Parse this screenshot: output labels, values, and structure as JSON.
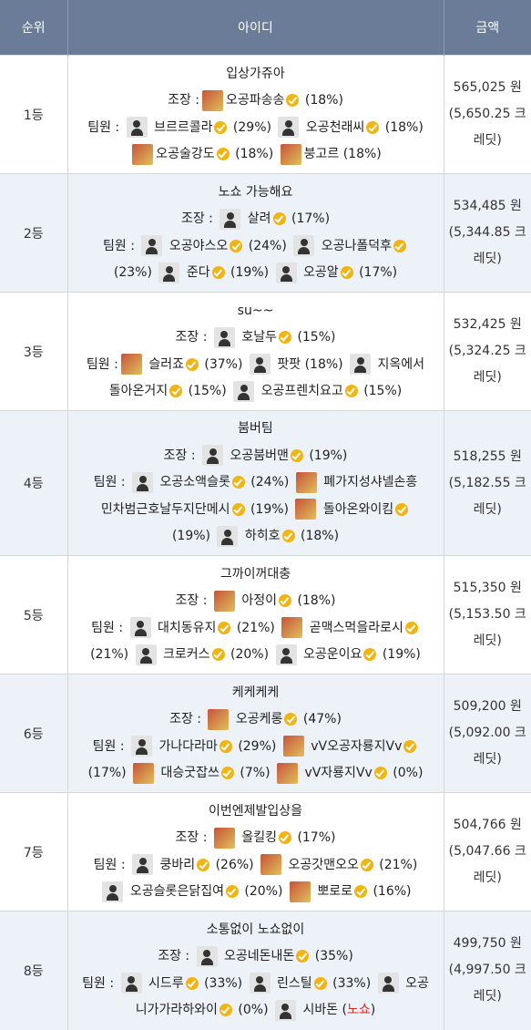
{
  "headers": {
    "rank": "순위",
    "id": "아이디",
    "amount": "금액"
  },
  "rows": [
    {
      "rank": "1등",
      "team": "입상가쥬아",
      "captain": "조장 :",
      "captain_name": "오공파송송",
      "captain_pct": "(18%)",
      "members": "팀원 :",
      "m1": "브르르콜라",
      "p1": "(29%)",
      "m2": "오공천래씨",
      "p2": "(18%)",
      "m3": "오공술강도",
      "p3": "(18%)",
      "m4": "붕고르",
      "p4": "(18%)",
      "amount": "565,025 원",
      "credit_a": "(5,650.25 크",
      "credit_b": "레딧)"
    },
    {
      "rank": "2등",
      "team": "노쇼 가능해요",
      "captain": "조장 :",
      "captain_name": "살려",
      "captain_pct": "(17%)",
      "members": "팀원 :",
      "m1": "오공야스오",
      "p1": "(24%)",
      "m2": "오공나폴덕후",
      "p2": "(23%)",
      "m3": "준다",
      "p3": "(19%)",
      "m4": "오공알",
      "p4": "(17%)",
      "amount": "534,485 원",
      "credit_a": "(5,344.85 크",
      "credit_b": "레딧)"
    },
    {
      "rank": "3등",
      "team": "su~~",
      "captain": "조장 :",
      "captain_name": "호날두",
      "captain_pct": "(15%)",
      "members": "팀원 :",
      "m1": "슬러죠",
      "p1": "(37%)",
      "m2": "팟팟",
      "p2": "(18%)",
      "m3a": "지옥에서",
      "m3b": "돌아온거지",
      "p3": "(15%)",
      "m4": "오공프렌치요고",
      "p4": "(15%)",
      "amount": "532,425 원",
      "credit_a": "(5,324.25 크",
      "credit_b": "레딧)"
    },
    {
      "rank": "4등",
      "team": "붐버팀",
      "captain": "조장 :",
      "captain_name": "오공붐버맨",
      "captain_pct": "(19%)",
      "members": "팀원 :",
      "m1": "오공소액슬롯",
      "p1": "(24%)",
      "m2a": "폐가지성샤넬손흥",
      "m2b": "민차범근호날두지단메시",
      "p2": "(19%)",
      "m3": "돌아온와이킴",
      "p3": "(19%)",
      "m4": "하히호",
      "p4": "(18%)",
      "amount": "518,255 원",
      "credit_a": "(5,182.55 크",
      "credit_b": "레딧)"
    },
    {
      "rank": "5등",
      "team": "그까이꺼대충",
      "captain": "조장 :",
      "captain_name": "아정이",
      "captain_pct": "(18%)",
      "members": "팀원 :",
      "m1": "대치동유지",
      "p1": "(21%)",
      "m2": "곧맥스먹을라로시",
      "p2": "(21%)",
      "m3": "크로커스",
      "p3": "(20%)",
      "m4": "오공운이요",
      "p4": "(19%)",
      "amount": "515,350 원",
      "credit_a": "(5,153.50 크",
      "credit_b": "레딧)"
    },
    {
      "rank": "6등",
      "team": "케케케케",
      "captain": "조장 :",
      "captain_name": "오공케롱",
      "captain_pct": "(47%)",
      "members": "팀원 :",
      "m1": "가나다라마",
      "p1": "(29%)",
      "m2": "vV오공자룡지Vv",
      "p2": "(17%)",
      "m3": "대승굿잡쓰",
      "p3": "(7%)",
      "m4": "vV자룡지Vv",
      "p4": "(0%)",
      "amount": "509,200 원",
      "credit_a": "(5,092.00 크",
      "credit_b": "레딧)"
    },
    {
      "rank": "7등",
      "team": "이번엔제발입상을",
      "captain": "조장 :",
      "captain_name": "올킬킹",
      "captain_pct": "(17%)",
      "members": "팀원 :",
      "m1": "쿵바리",
      "p1": "(26%)",
      "m2": "오공갓맨오오",
      "p2": "(21%)",
      "m3": "오공슬롯은닭집여",
      "p3": "(20%)",
      "m4": "뽀로로",
      "p4": "(16%)",
      "amount": "504,766 원",
      "credit_a": "(5,047.66 크",
      "credit_b": "레딧)"
    },
    {
      "rank": "8등",
      "team": "소통없이 노쇼없이",
      "captain": "조장 :",
      "captain_name": "오공네돈내돈",
      "captain_pct": "(35%)",
      "members": "팀원 :",
      "m1": "시드루",
      "p1": "(33%)",
      "m2": "린스틸",
      "p2": "(33%)",
      "m3a": "오공",
      "m3b": "니가가라하와이",
      "p3": "(0%)",
      "m4": "시바돈",
      "p4": "(노쇼)",
      "amount": "499,750 원",
      "credit_a": "(4,997.50 크",
      "credit_b": "레딧)"
    }
  ],
  "icons": {
    "default_avatar": "person-icon",
    "verified": "verified-badge-icon"
  },
  "colors": {
    "header_bg": "#6b7c98",
    "alt_row_bg": "#edf1f8",
    "badge": "#f0b512",
    "no_show": "#e0241d"
  }
}
